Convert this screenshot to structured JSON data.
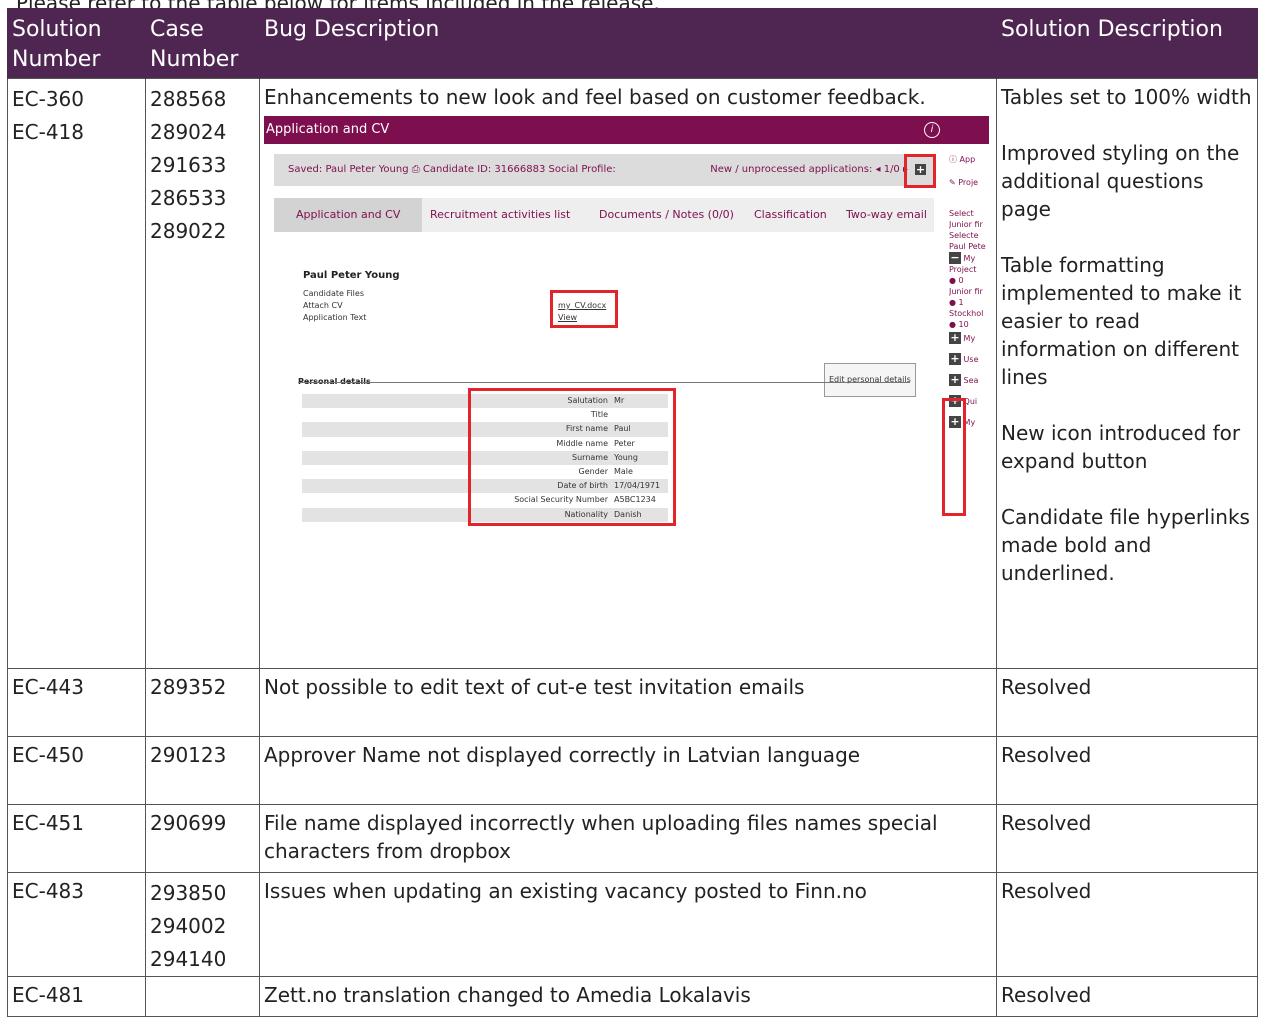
{
  "intro": "Please refer to the table below for items included in the release.",
  "headers": {
    "solution_number": "Solution Number",
    "case_number": "Case Number",
    "bug_description": "Bug Description",
    "solution_description": "Solution Description"
  },
  "rows": [
    {
      "solutions": [
        "EC-360",
        "EC-418"
      ],
      "cases": [
        "288568",
        "289024",
        "291633",
        "286533",
        "289022"
      ],
      "bug": "Enhancements to new look and feel based on customer feedback.",
      "solution_items": [
        "Tables set to 100% width",
        "Improved styling on the additional questions page",
        "Table formatting implemented to make it easier to read information on different lines",
        "New icon introduced for expand button",
        "Candidate file hyperlinks made bold and underlined."
      ]
    },
    {
      "solution": "EC-443",
      "cases": [
        "289352"
      ],
      "bug": "Not possible to edit text of cut-e test invitation emails",
      "solution_text": "Resolved"
    },
    {
      "solution": "EC-450",
      "cases": [
        "290123"
      ],
      "bug": "Approver Name not displayed correctly in Latvian language",
      "solution_text": "Resolved"
    },
    {
      "solution": "EC-451",
      "cases": [
        "290699"
      ],
      "bug": "File name displayed incorrectly when uploading files names special characters from dropbox",
      "solution_text": "Resolved"
    },
    {
      "solution": "EC-483",
      "cases": [
        "293850",
        "294002",
        "294140"
      ],
      "bug": "Issues when updating an existing vacancy posted to Finn.no",
      "solution_text": "Resolved"
    },
    {
      "solution": "EC-481",
      "cases": [
        ""
      ],
      "bug": "Zett.no translation changed to Amedia Lokalavis",
      "solution_text": "Resolved"
    }
  ],
  "screenshot": {
    "title": "Application and CV",
    "info_icon": "info-icon",
    "toolbar_saved": "Saved:  Paul Peter Young  ⎙ Candidate ID: 31666883  Social Profile:",
    "toolbar_apps": "New / unprocessed applications: ◂ 1/0 ▸",
    "tabs": [
      "Application and CV",
      "Recruitment activities list",
      "Documents / Notes (0/0)",
      "Classification",
      "Two-way email"
    ],
    "candidate_name": "Paul Peter Young",
    "file_labels": [
      "Candidate Files",
      "Attach CV",
      "Application Text"
    ],
    "file_links": [
      "my_CV.docx",
      "View"
    ],
    "personal_details_label": "Personal details",
    "edit_button": "Edit personal details",
    "details": [
      {
        "k": "Salutation",
        "v": "Mr"
      },
      {
        "k": "Title",
        "v": ""
      },
      {
        "k": "First name",
        "v": "Paul"
      },
      {
        "k": "Middle name",
        "v": "Peter"
      },
      {
        "k": "Surname",
        "v": "Young"
      },
      {
        "k": "Gender",
        "v": "Male"
      },
      {
        "k": "Date of birth",
        "v": "17/04/1971"
      },
      {
        "k": "Social Security Number",
        "v": "A5BC1234"
      },
      {
        "k": "Nationality",
        "v": "Danish"
      }
    ],
    "sidebar": [
      "App",
      "Proje",
      "Select",
      "Junior fir",
      "Selecte",
      "Paul Pete",
      "My",
      "Project",
      "0",
      "Junior fir",
      "1",
      "Stockhol",
      "10",
      "My",
      "Use",
      "Sea",
      "Qui",
      "My"
    ],
    "accent_color": "#7d0f4f",
    "highlight_color": "#e2242b"
  },
  "colors": {
    "header_bg": "#4f2652",
    "header_text": "#ffffff"
  }
}
